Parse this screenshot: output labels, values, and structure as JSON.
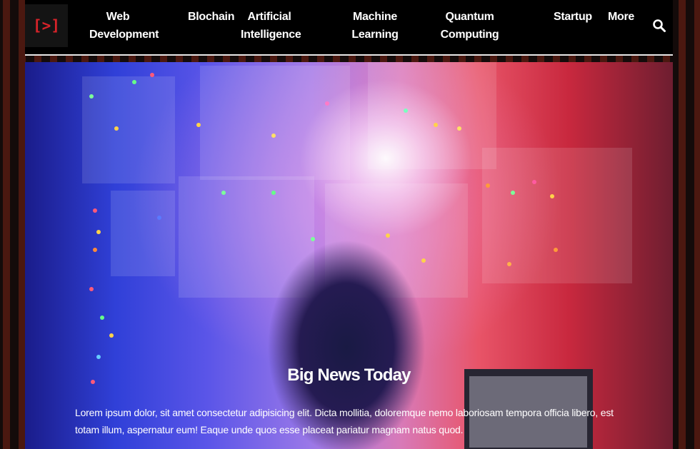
{
  "logo": {
    "text": "[>]"
  },
  "nav": {
    "web_development": "Web Development",
    "blockchain": "Blochain",
    "artificial_intelligence": "Artificial Intelligence",
    "machine_learning": "Machine Learning",
    "quantum_computing": "Quantum Computing",
    "startup": "Startup",
    "more": "More",
    "search_icon": "search-icon"
  },
  "hero": {
    "title": "Big News Today",
    "body": "Lorem ipsum dolor, sit amet consectetur adipisicing elit. Dicta mollitia, doloremque nemo laboriosam tempora officia libero, est totam illum, aspernatur eum! Eaque unde quos esse placeat pariatur magnam natus quod."
  },
  "colors": {
    "accent": "#d8232a",
    "navbar_bg": "#000000",
    "page_bg": "#140b0a"
  }
}
